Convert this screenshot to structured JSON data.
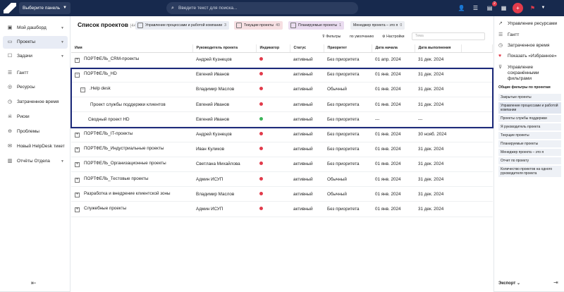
{
  "topbar": {
    "panel_select": "Выберите панель",
    "search_placeholder": "Введите текст для поиска...",
    "notif_badge": "2",
    "icons": [
      "user-icon",
      "sliders-icon",
      "chat-icon",
      "calendar-icon",
      "plus-icon",
      "flag-icon",
      "chevron-down-icon"
    ]
  },
  "sidebar": {
    "items": [
      {
        "label": "Мой дашборд",
        "icon": "dashboard-icon",
        "chevron": true
      },
      {
        "label": "Проекты",
        "icon": "folder-icon",
        "chevron": true,
        "active": true
      },
      {
        "label": "Задачи",
        "icon": "tasks-icon",
        "chevron": true
      },
      {
        "label": "Гантт",
        "icon": "gantt-icon"
      },
      {
        "label": "Ресурсы",
        "icon": "resources-icon"
      },
      {
        "label": "Затраченное время",
        "icon": "clock-icon"
      },
      {
        "label": "Риски",
        "icon": "risk-icon"
      },
      {
        "label": "Проблемы",
        "icon": "problem-icon"
      },
      {
        "label": "Новый HelpDesk тикет",
        "icon": "ticket-icon"
      },
      {
        "label": "Отчёты Отдела",
        "icon": "report-icon",
        "chevron": true
      }
    ]
  },
  "main": {
    "title": "Список проектов",
    "count": "(44)",
    "chips": [
      {
        "label": "Управление процессами и работой компании",
        "n": "3",
        "color": "#e9ecf3"
      },
      {
        "label": "Текущие проекты",
        "n": "40",
        "color": "#f6dfe2"
      },
      {
        "label": "Планируемые проекты",
        "n": "1",
        "color": "#eadcf0"
      },
      {
        "label": "Менеджер проекта – это я",
        "n": "0",
        "color": "#eceef2"
      }
    ],
    "filters_label": "Фильтры",
    "default_label": "по умолчанию",
    "settings_label": "Настройки",
    "filter_placeholder": "Тема",
    "columns": [
      "Имя",
      "Руководитель проекта",
      "Индикатор",
      "Статус",
      "Приоритет",
      "Дата начала",
      "Дата выполнения"
    ],
    "rows": [
      {
        "name": "ПОРТФЕЛЬ_CRM-проекты",
        "toggle": "+",
        "indent": 0,
        "manager": "Андрей Кузнецов",
        "indicator": "#e23b4b",
        "status": "активный",
        "priority": "Без приоритета",
        "start": "01 апр. 2024",
        "due": "31 дек. 2024"
      },
      {
        "name": "ПОРТФЕЛЬ_HD",
        "toggle": "−",
        "indent": 0,
        "manager": "Евгений Иванов",
        "indicator": "#e23b4b",
        "status": "активный",
        "priority": "Без приоритета",
        "start": "01 янв. 2024",
        "due": "31 дек. 2024"
      },
      {
        "name": ".Help desk",
        "toggle": "−",
        "indent": 1,
        "manager": "Владимир Маслов",
        "indicator": "#e23b4b",
        "status": "активный",
        "priority": "Обычный",
        "start": "01 янв. 2024",
        "due": "31 дек. 2024"
      },
      {
        "name": "Проект службы поддержки клиентов",
        "toggle": "",
        "indent": 2,
        "manager": "Евгений Иванов",
        "indicator": "#e23b4b",
        "status": "активный",
        "priority": "Без приоритета",
        "start": "01 янв. 2024",
        "due": "31 дек. 2024"
      },
      {
        "name": "Сводный проект HD",
        "toggle": "",
        "indent": 1,
        "manager": "Евгений Иванов",
        "indicator": "#3cb55a",
        "status": "активный",
        "priority": "Без приоритета",
        "start": "---",
        "due": "---"
      },
      {
        "name": "ПОРТФЕЛЬ_IT-проекты",
        "toggle": "+",
        "indent": 0,
        "manager": "Андрей Кузнецов",
        "indicator": "#e23b4b",
        "status": "активный",
        "priority": "Без приоритета",
        "start": "01 янв. 2024",
        "due": "30 нояб. 2024"
      },
      {
        "name": "ПОРТФЕЛЬ_Индустриальные проекты",
        "toggle": "+",
        "indent": 0,
        "manager": "Иван Куликов",
        "indicator": "#e23b4b",
        "status": "активный",
        "priority": "Без приоритета",
        "start": "01 янв. 2024",
        "due": "31 дек. 2024"
      },
      {
        "name": "ПОРТФЕЛЬ_Организационные проекты",
        "toggle": "+",
        "indent": 0,
        "manager": "Светлана Михайлова",
        "indicator": "#e23b4b",
        "status": "активный",
        "priority": "Без приоритета",
        "start": "01 янв. 2024",
        "due": "31 дек. 2024"
      },
      {
        "name": "ПОРТФЕЛЬ_Тестовые проекты",
        "toggle": "+",
        "indent": 0,
        "manager": "Админ ИСУП",
        "indicator": "#e23b4b",
        "status": "активный",
        "priority": "Обычный",
        "start": "01 янв. 2024",
        "due": "31 дек. 2024"
      },
      {
        "name": "Разработка и внедрение клиентской зоны",
        "toggle": "+",
        "indent": 0,
        "manager": "Владимир Маслов",
        "indicator": "#e23b4b",
        "status": "активный",
        "priority": "Обычный",
        "start": "01 янв. 2024",
        "due": "31 дек. 2024"
      },
      {
        "name": "Служебные проекты",
        "toggle": "+",
        "indent": 0,
        "manager": "Админ ИСУП",
        "indicator": "#e23b4b",
        "status": "активный",
        "priority": "Без приоритета",
        "start": "01 янв. 2024",
        "due": "31 дек. 2024"
      }
    ]
  },
  "right_panel": {
    "actions": [
      {
        "label": "Управление ресурсами",
        "icon": "chart-icon"
      },
      {
        "label": "Гантт",
        "icon": "gantt-icon"
      },
      {
        "label": "Затраченное время",
        "icon": "clock-icon"
      },
      {
        "label": "Показать «Избранное»",
        "icon": "heart-icon"
      },
      {
        "label": "Управление сохранёнными фильтрами",
        "icon": "funnel-icon"
      }
    ],
    "filters_heading": "Общие фильтры по проектам",
    "filters": [
      "Закрытые проекты",
      "Управление процессами и работой компании",
      "Проекты службы поддержки",
      "Я руководитель проекта",
      "Текущие проекты",
      "Планируемые проекты",
      "Менеджер проекта – это я",
      "Отчет по проекту",
      "Количество проектов на одного руководителя проекта"
    ],
    "export_label": "Экспорт"
  }
}
